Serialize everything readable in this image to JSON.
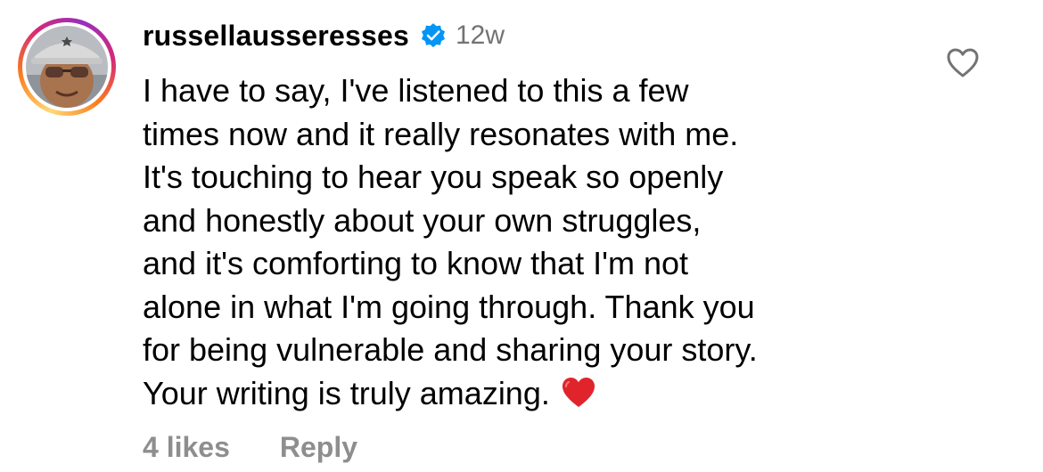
{
  "comment": {
    "username": "russellausseresses",
    "verified": true,
    "age": "12w",
    "text": "I have to say, I've listened to this a few\ntimes now and it really resonates with me.\nIt's touching to hear you speak so openly\nand honestly about your own struggles,\nand it's comforting to know that I'm not\nalone in what I'm going through. Thank you\nfor being vulnerable and sharing your story.\nYour writing is truly amazing.",
    "emoji": "red-heart",
    "likes_label": "4 likes",
    "reply_label": "Reply"
  },
  "icons": {
    "verified_badge": "verified-badge-icon",
    "like": "heart-outline-icon",
    "avatar_ring": "story-ring"
  },
  "colors": {
    "verified_blue": "#0095f6",
    "muted_text": "#8e8e8e",
    "age_text": "#737373",
    "emoji_red": "#e0242b",
    "story_ring_start": "#feda75",
    "story_ring_end": "#962fbf"
  }
}
